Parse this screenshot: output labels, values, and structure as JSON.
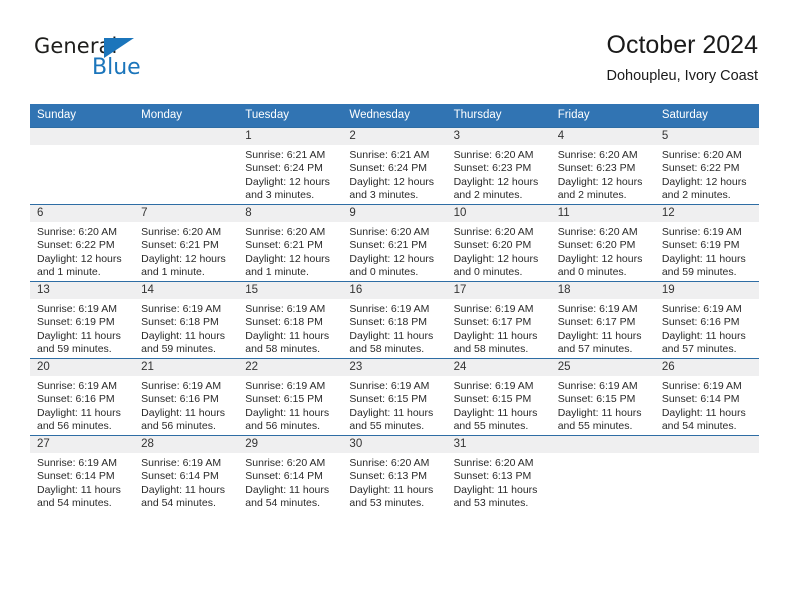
{
  "brand": {
    "name_top": "General",
    "name_bottom": "Blue",
    "accent_color": "#1b75bb"
  },
  "header": {
    "title": "October 2024",
    "subtitle": "Dohoupleu, Ivory Coast"
  },
  "theme": {
    "header_blue": "#3174b3",
    "daynum_strip": "#efeff0",
    "text": "#2a2a2a"
  },
  "weekdays": [
    "Sunday",
    "Monday",
    "Tuesday",
    "Wednesday",
    "Thursday",
    "Friday",
    "Saturday"
  ],
  "weeks": [
    [
      {
        "day": "",
        "lines": []
      },
      {
        "day": "",
        "lines": []
      },
      {
        "day": "1",
        "lines": [
          "Sunrise: 6:21 AM",
          "Sunset: 6:24 PM",
          "Daylight: 12 hours",
          "and 3 minutes."
        ]
      },
      {
        "day": "2",
        "lines": [
          "Sunrise: 6:21 AM",
          "Sunset: 6:24 PM",
          "Daylight: 12 hours",
          "and 3 minutes."
        ]
      },
      {
        "day": "3",
        "lines": [
          "Sunrise: 6:20 AM",
          "Sunset: 6:23 PM",
          "Daylight: 12 hours",
          "and 2 minutes."
        ]
      },
      {
        "day": "4",
        "lines": [
          "Sunrise: 6:20 AM",
          "Sunset: 6:23 PM",
          "Daylight: 12 hours",
          "and 2 minutes."
        ]
      },
      {
        "day": "5",
        "lines": [
          "Sunrise: 6:20 AM",
          "Sunset: 6:22 PM",
          "Daylight: 12 hours",
          "and 2 minutes."
        ]
      }
    ],
    [
      {
        "day": "6",
        "lines": [
          "Sunrise: 6:20 AM",
          "Sunset: 6:22 PM",
          "Daylight: 12 hours",
          "and 1 minute."
        ]
      },
      {
        "day": "7",
        "lines": [
          "Sunrise: 6:20 AM",
          "Sunset: 6:21 PM",
          "Daylight: 12 hours",
          "and 1 minute."
        ]
      },
      {
        "day": "8",
        "lines": [
          "Sunrise: 6:20 AM",
          "Sunset: 6:21 PM",
          "Daylight: 12 hours",
          "and 1 minute."
        ]
      },
      {
        "day": "9",
        "lines": [
          "Sunrise: 6:20 AM",
          "Sunset: 6:21 PM",
          "Daylight: 12 hours",
          "and 0 minutes."
        ]
      },
      {
        "day": "10",
        "lines": [
          "Sunrise: 6:20 AM",
          "Sunset: 6:20 PM",
          "Daylight: 12 hours",
          "and 0 minutes."
        ]
      },
      {
        "day": "11",
        "lines": [
          "Sunrise: 6:20 AM",
          "Sunset: 6:20 PM",
          "Daylight: 12 hours",
          "and 0 minutes."
        ]
      },
      {
        "day": "12",
        "lines": [
          "Sunrise: 6:19 AM",
          "Sunset: 6:19 PM",
          "Daylight: 11 hours",
          "and 59 minutes."
        ]
      }
    ],
    [
      {
        "day": "13",
        "lines": [
          "Sunrise: 6:19 AM",
          "Sunset: 6:19 PM",
          "Daylight: 11 hours",
          "and 59 minutes."
        ]
      },
      {
        "day": "14",
        "lines": [
          "Sunrise: 6:19 AM",
          "Sunset: 6:18 PM",
          "Daylight: 11 hours",
          "and 59 minutes."
        ]
      },
      {
        "day": "15",
        "lines": [
          "Sunrise: 6:19 AM",
          "Sunset: 6:18 PM",
          "Daylight: 11 hours",
          "and 58 minutes."
        ]
      },
      {
        "day": "16",
        "lines": [
          "Sunrise: 6:19 AM",
          "Sunset: 6:18 PM",
          "Daylight: 11 hours",
          "and 58 minutes."
        ]
      },
      {
        "day": "17",
        "lines": [
          "Sunrise: 6:19 AM",
          "Sunset: 6:17 PM",
          "Daylight: 11 hours",
          "and 58 minutes."
        ]
      },
      {
        "day": "18",
        "lines": [
          "Sunrise: 6:19 AM",
          "Sunset: 6:17 PM",
          "Daylight: 11 hours",
          "and 57 minutes."
        ]
      },
      {
        "day": "19",
        "lines": [
          "Sunrise: 6:19 AM",
          "Sunset: 6:16 PM",
          "Daylight: 11 hours",
          "and 57 minutes."
        ]
      }
    ],
    [
      {
        "day": "20",
        "lines": [
          "Sunrise: 6:19 AM",
          "Sunset: 6:16 PM",
          "Daylight: 11 hours",
          "and 56 minutes."
        ]
      },
      {
        "day": "21",
        "lines": [
          "Sunrise: 6:19 AM",
          "Sunset: 6:16 PM",
          "Daylight: 11 hours",
          "and 56 minutes."
        ]
      },
      {
        "day": "22",
        "lines": [
          "Sunrise: 6:19 AM",
          "Sunset: 6:15 PM",
          "Daylight: 11 hours",
          "and 56 minutes."
        ]
      },
      {
        "day": "23",
        "lines": [
          "Sunrise: 6:19 AM",
          "Sunset: 6:15 PM",
          "Daylight: 11 hours",
          "and 55 minutes."
        ]
      },
      {
        "day": "24",
        "lines": [
          "Sunrise: 6:19 AM",
          "Sunset: 6:15 PM",
          "Daylight: 11 hours",
          "and 55 minutes."
        ]
      },
      {
        "day": "25",
        "lines": [
          "Sunrise: 6:19 AM",
          "Sunset: 6:15 PM",
          "Daylight: 11 hours",
          "and 55 minutes."
        ]
      },
      {
        "day": "26",
        "lines": [
          "Sunrise: 6:19 AM",
          "Sunset: 6:14 PM",
          "Daylight: 11 hours",
          "and 54 minutes."
        ]
      }
    ],
    [
      {
        "day": "27",
        "lines": [
          "Sunrise: 6:19 AM",
          "Sunset: 6:14 PM",
          "Daylight: 11 hours",
          "and 54 minutes."
        ]
      },
      {
        "day": "28",
        "lines": [
          "Sunrise: 6:19 AM",
          "Sunset: 6:14 PM",
          "Daylight: 11 hours",
          "and 54 minutes."
        ]
      },
      {
        "day": "29",
        "lines": [
          "Sunrise: 6:20 AM",
          "Sunset: 6:14 PM",
          "Daylight: 11 hours",
          "and 54 minutes."
        ]
      },
      {
        "day": "30",
        "lines": [
          "Sunrise: 6:20 AM",
          "Sunset: 6:13 PM",
          "Daylight: 11 hours",
          "and 53 minutes."
        ]
      },
      {
        "day": "31",
        "lines": [
          "Sunrise: 6:20 AM",
          "Sunset: 6:13 PM",
          "Daylight: 11 hours",
          "and 53 minutes."
        ]
      },
      {
        "day": "",
        "lines": []
      },
      {
        "day": "",
        "lines": []
      }
    ]
  ]
}
